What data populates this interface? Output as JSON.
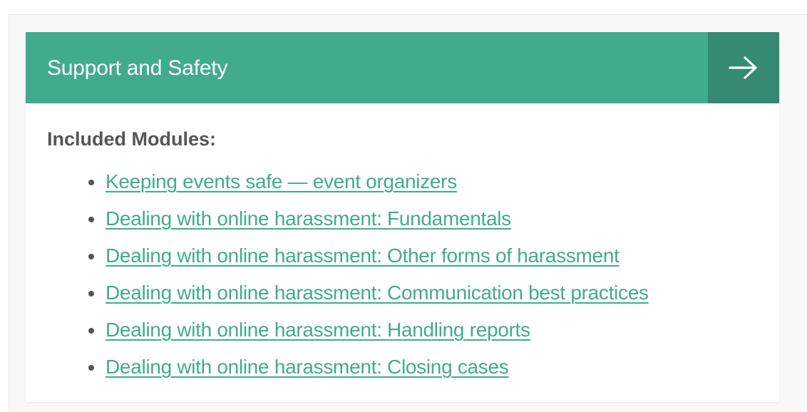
{
  "card": {
    "title": "Support and Safety",
    "arrow_icon": "arrow-right-icon",
    "header_color": "#41ab8d",
    "arrow_bg_color": "#368a72"
  },
  "modules": {
    "heading": "Included Modules:",
    "link_color": "#41ab8d",
    "items": [
      {
        "label": "Keeping events safe — event organizers"
      },
      {
        "label": "Dealing with online harassment: Fundamentals"
      },
      {
        "label": "Dealing with online harassment: Other forms of harassment"
      },
      {
        "label": "Dealing with online harassment: Communication best practices"
      },
      {
        "label": "Dealing with online harassment: Handling reports"
      },
      {
        "label": "Dealing with online harassment: Closing cases"
      }
    ]
  }
}
